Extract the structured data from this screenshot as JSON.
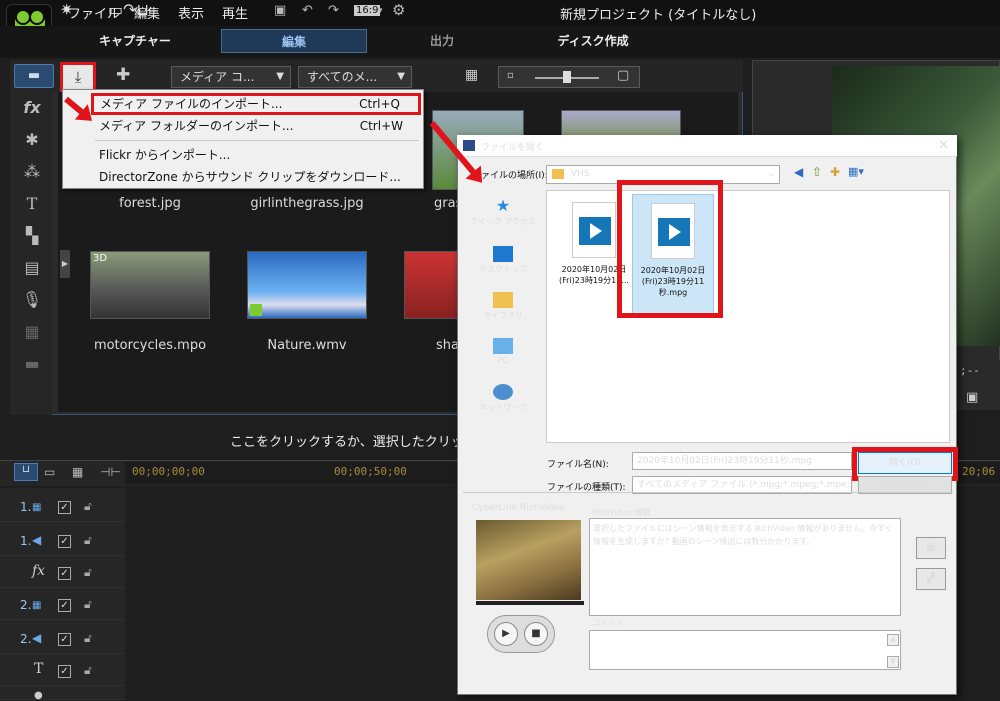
{
  "app": {
    "menu": [
      "ファイル",
      "編集",
      "表示",
      "再生"
    ],
    "aspect": "16:9",
    "window_title": "新規プロジェクト (タイトルなし)"
  },
  "tabs": [
    "キャプチャー",
    "編集",
    "出力",
    "ディスク作成"
  ],
  "library": {
    "filter1": "メディア コ...",
    "filter2": "すべてのメ...",
    "thumbs": [
      "forest.jpg",
      "girlinthegrass.jpg",
      "gras",
      "motorcycles.mpo",
      "Nature.wmv",
      "sha"
    ],
    "thumb_badge": "3D"
  },
  "import_menu": [
    {
      "label": "メディア ファイルのインポート...",
      "shortcut": "Ctrl+Q"
    },
    {
      "label": "メディア フォルダーのインポート...",
      "shortcut": "Ctrl+W"
    },
    {
      "label": "Flickr からインポート...",
      "shortcut": ""
    },
    {
      "label": "DirectorZone からサウンド クリップをダウンロード...",
      "shortcut": ""
    }
  ],
  "mid_toolbar": {
    "hint": "ここをクリックするか、選択したクリップ"
  },
  "timeline": {
    "times": [
      "00;00;00;00",
      "00;00;50;00",
      "20;06"
    ],
    "tracks": [
      "1.",
      "1.",
      "fx",
      "2.",
      "2.",
      "T",
      ""
    ]
  },
  "preview": {
    "timecode": ";--"
  },
  "dialog": {
    "title": "ファイルを開く",
    "lookin_label": "ファイルの場所(I):",
    "lookin_value": "VHS",
    "places": [
      "クイック アクセス",
      "デスクトップ",
      "ライブラリ",
      "PC",
      "ネットワーク"
    ],
    "files": [
      {
        "name": "2020年10月02日(Fri)23時19分11..."
      },
      {
        "name": "2020年10月02日(Fri)23時19分11秒.mpg"
      }
    ],
    "filename_label": "ファイル名(N):",
    "filename_value": "2020年10月02日(Fri)23時19分11秒.mpg",
    "filetype_label": "ファイルの種類(T):",
    "filetype_value": "すべてのメディア ファイル (*.mpg;*.mpeg;*.mpe;*.dat;*...",
    "open_label": "開く(O)",
    "cancel_label": "キャンセル",
    "richvideo_section": "CyberLink RichVideo",
    "richvideo_info_label": "RichVideo 情報",
    "richvideo_info_text": "選択したファイルにはシーン情報を表示する RichVideo 情報がありません。今すぐ情報を生成しますか? 動画のシーン検出には数分かかります。",
    "comment_label": "コメント"
  },
  "colors": {
    "highlight": "#e0141b",
    "accent": "#9cc3ef"
  }
}
